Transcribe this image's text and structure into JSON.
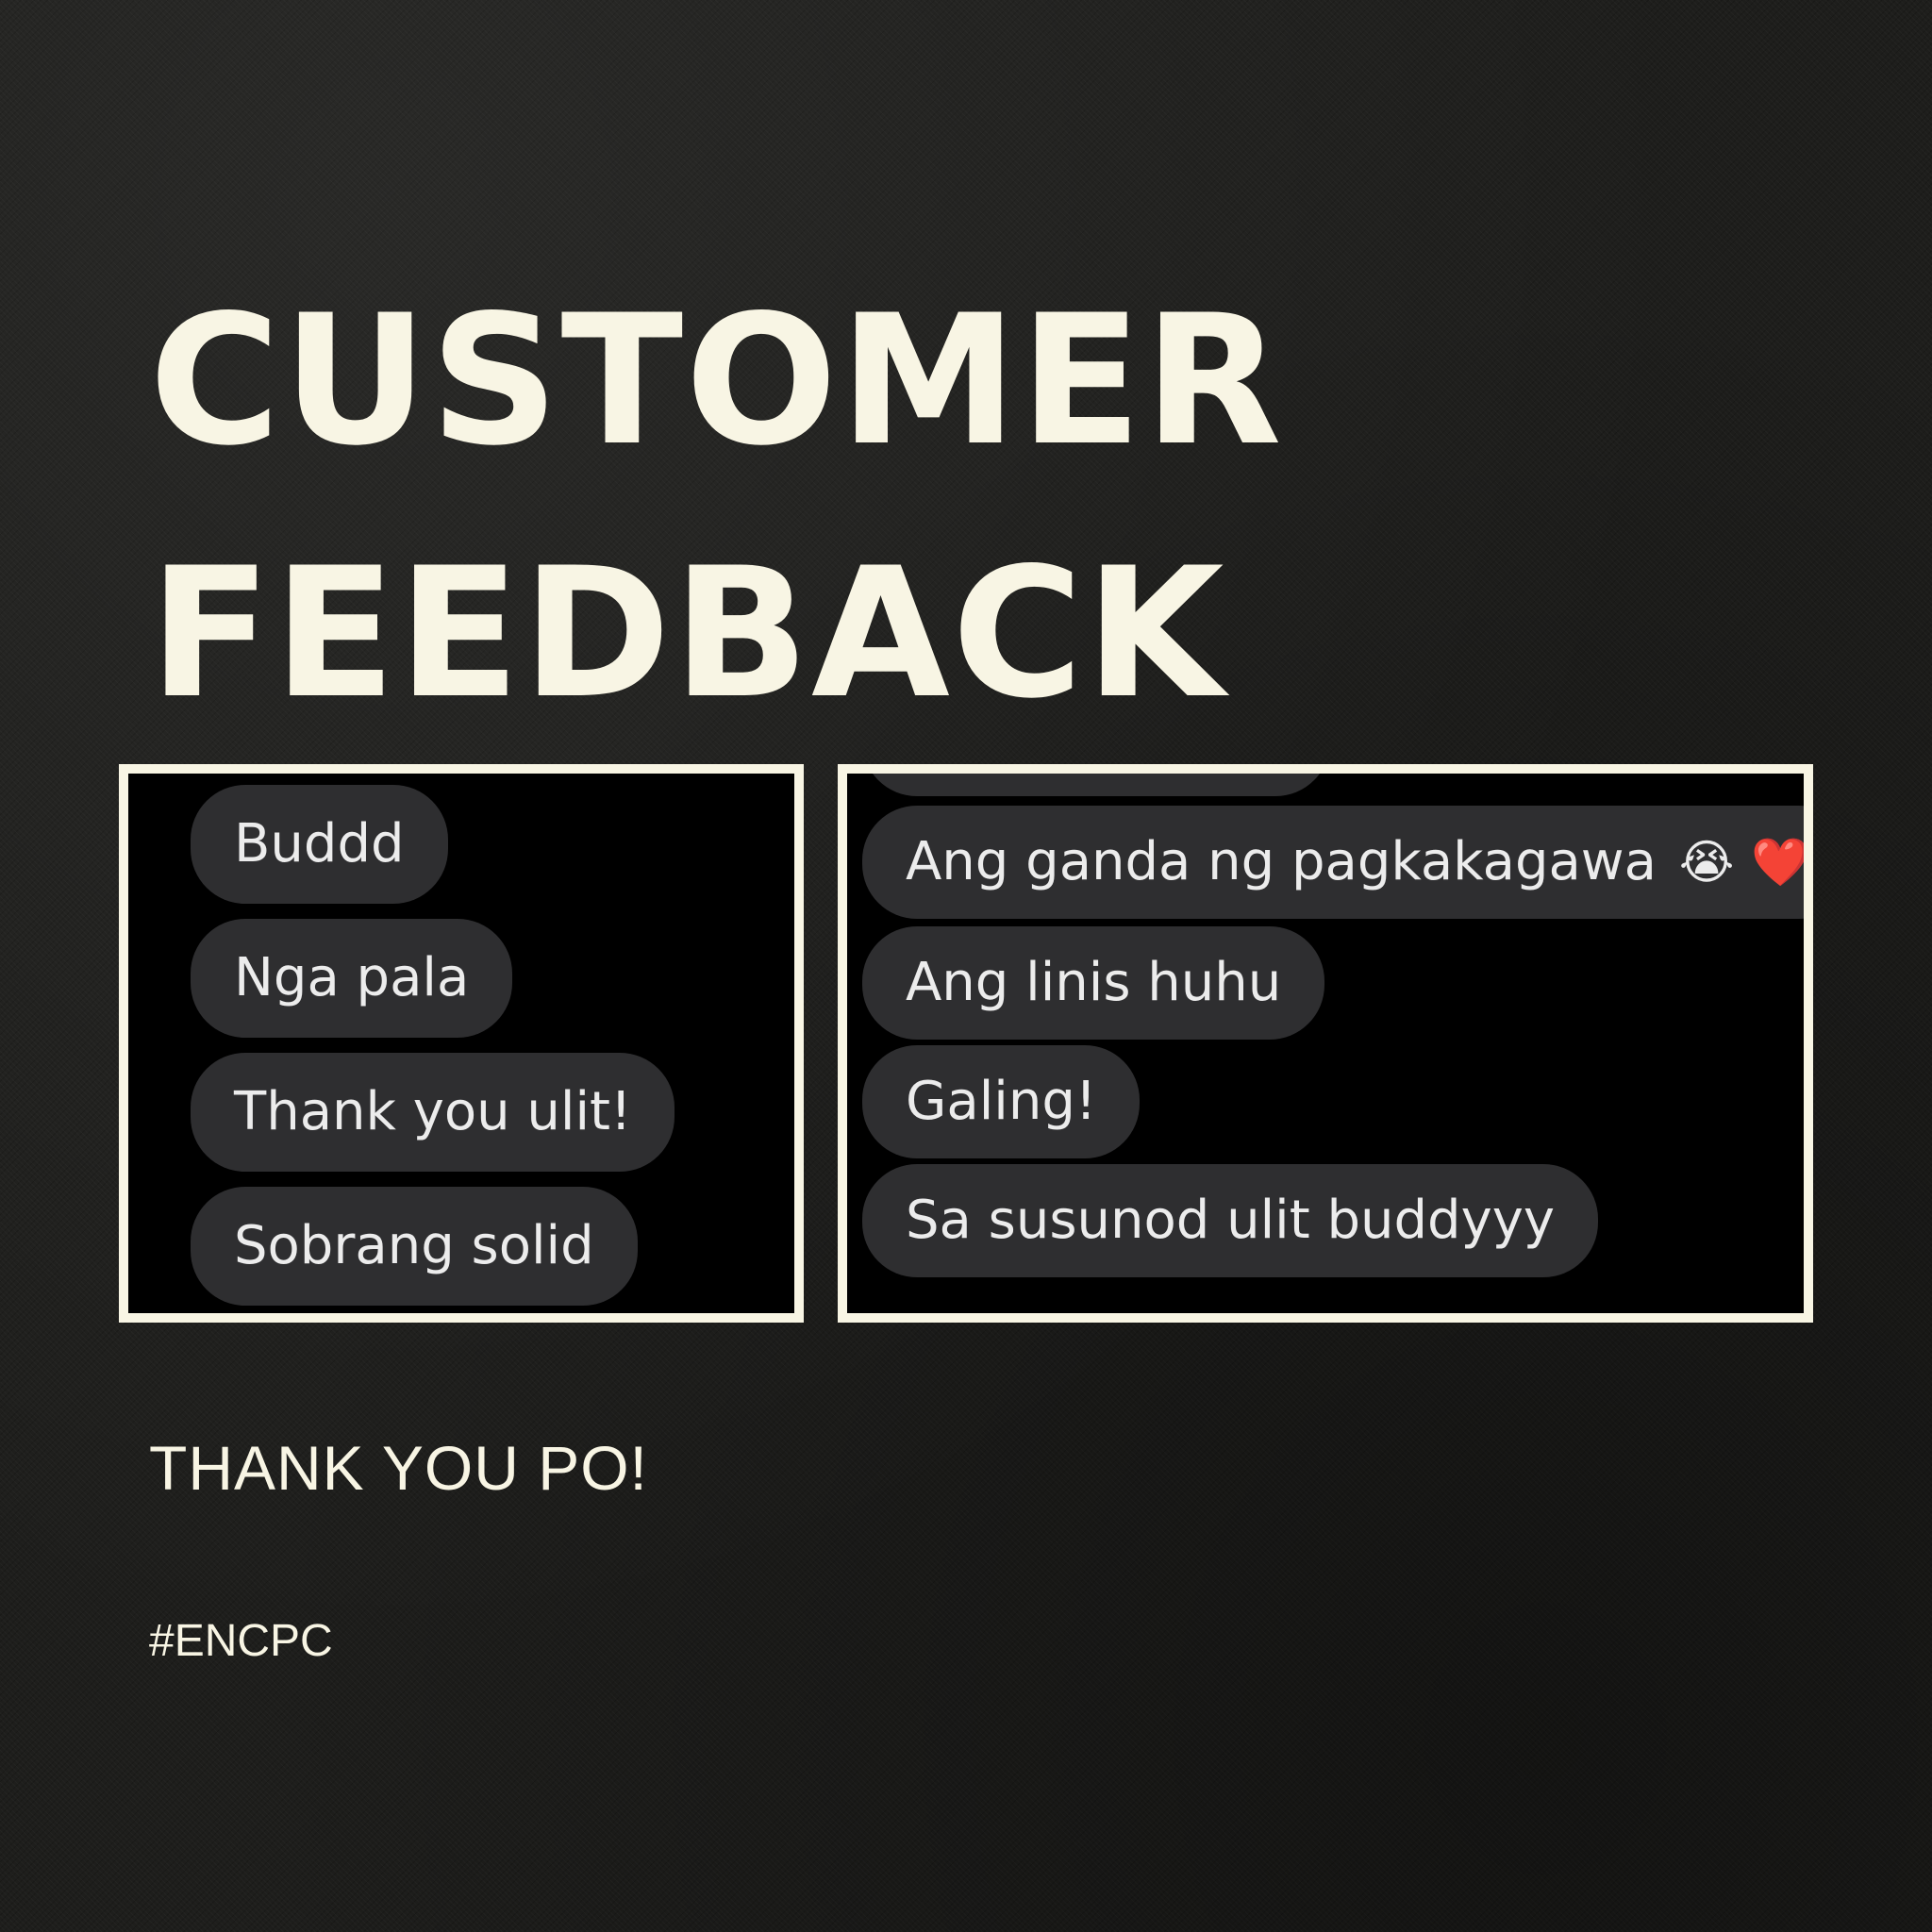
{
  "headline": {
    "line1": "CUSTOMER",
    "line2": "FEEDBACK"
  },
  "panels": {
    "left": {
      "messages": [
        "Buddd",
        "Nga pala",
        "Thank you ulit!",
        "Sobrang solid"
      ]
    },
    "right": {
      "messages": [
        "Ang ganda ng pagkakagawa",
        "Ang linis huhu",
        "Galing!",
        "Sa susunod ulit buddyyy"
      ],
      "emoji": [
        "crying-face-emoji",
        "red-heart-emoji"
      ]
    }
  },
  "footer": {
    "thanks": "THANK YOU PO!",
    "hashtag": "#ENCPC"
  },
  "colors": {
    "background": "#1e1e1c",
    "cream": "#f8f5e4",
    "bubble": "#2e2e30",
    "chat_background": "#000000"
  }
}
